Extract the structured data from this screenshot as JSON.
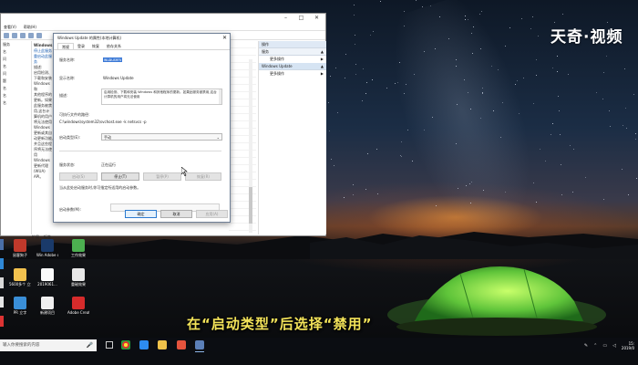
{
  "logo": {
    "text": "天奇·视频"
  },
  "subtitle": {
    "text": "在“启动类型”后选择“禁用”"
  },
  "services_window": {
    "menu": [
      "查看(V)",
      "帮助(H)"
    ],
    "left_nav": [
      {
        "label": "服务"
      },
      {
        "label": "名"
      },
      {
        "label": "问"
      },
      {
        "label": "名"
      },
      {
        "label": "问"
      },
      {
        "label": "题"
      },
      {
        "label": "名"
      },
      {
        "label": "名"
      },
      {
        "label": "名"
      }
    ],
    "desc_heading": "Windows",
    "desc_links": [
      "停止此服务",
      "重启动此服务"
    ],
    "desc_body": [
      "描述:",
      "启用检测、",
      "下载和安装",
      "Windows 和",
      "其他程序的",
      "更新。如果",
      "此服务被禁",
      "用,这台计",
      "算机的用户",
      "将无法使用",
      "Windows",
      "更新或其自",
      "动更新功能,",
      "并且这些程",
      "序将无法使",
      "用 Windows",
      "更新代理",
      "(WUA) API。"
    ],
    "tabs": [
      "扩展",
      "标准"
    ],
    "actions": {
      "header1": "操作",
      "group1": "服务",
      "group1_more": "更多操作",
      "group2": "Windows Update",
      "group2_more": "更多操作"
    }
  },
  "dialog": {
    "title": "Windows Update 的属性(本地计算机)",
    "close_glyph": "✕",
    "tabs": [
      "常规",
      "登录",
      "恢复",
      "依存关系"
    ],
    "service_name_label": "服务名称:",
    "service_name_value": "wuauserv",
    "display_name_label": "显示名称:",
    "display_name_value": "Windows Update",
    "description_label": "描述:",
    "description_value": "启用检测、下载和安装 Windows 和其他程序的更新。如果此服务被禁用,这台计算机的用户将无法使用",
    "exe_path_label": "可执行文件的路径:",
    "exe_path_value": "C:\\windows\\system32\\svchost.exe -k netsvcs -p",
    "startup_type_label": "启动类型(E):",
    "startup_type_value": "手动",
    "service_status_label": "服务状态:",
    "service_status_value": "正在运行",
    "buttons": {
      "start": "启动(S)",
      "stop": "停止(T)",
      "pause": "暂停(P)",
      "resume": "恢复(R)"
    },
    "start_params_hint": "当从此处启动服务时,你可指定所适用的启动参数。",
    "start_params_label": "启动参数(M):",
    "ok": "确定",
    "cancel": "取消",
    "apply": "应用(A)"
  },
  "desktop_icons": [
    {
      "label": "",
      "color": "#4a6fa8"
    },
    {
      "label": "",
      "color": "#2f89d8"
    },
    {
      "label": "",
      "color": "#d8d8d8"
    },
    {
      "label": "",
      "color": "#e6e6e6"
    },
    {
      "label": "",
      "color": "#d33"
    },
    {
      "label": "鼠客狗子",
      "color": "#c0392b"
    },
    {
      "label": "Win Adobe ce 2018 ...",
      "color": "#1a3a6a"
    },
    {
      "label": "工作效果",
      "color": "#4caf50"
    },
    {
      "label": "5600多个 立字手卷体...",
      "color": "#f2c14e"
    },
    {
      "label": "2019061...",
      "color": "#fafafa"
    },
    {
      "label": "重磁效果",
      "color": "#e8e8e8"
    },
    {
      "label": "PR 立字",
      "color": "#3a8fd8"
    },
    {
      "label": "新建项目",
      "color": "#f0f0f0"
    },
    {
      "label": "Adobe Creat...",
      "color": "#d62b2b"
    }
  ],
  "taskbar": {
    "search_placeholder": "输入你要搜索的内容",
    "mic_glyph": "🎤",
    "tray_time": "15:",
    "tray_date": "2019/0"
  }
}
